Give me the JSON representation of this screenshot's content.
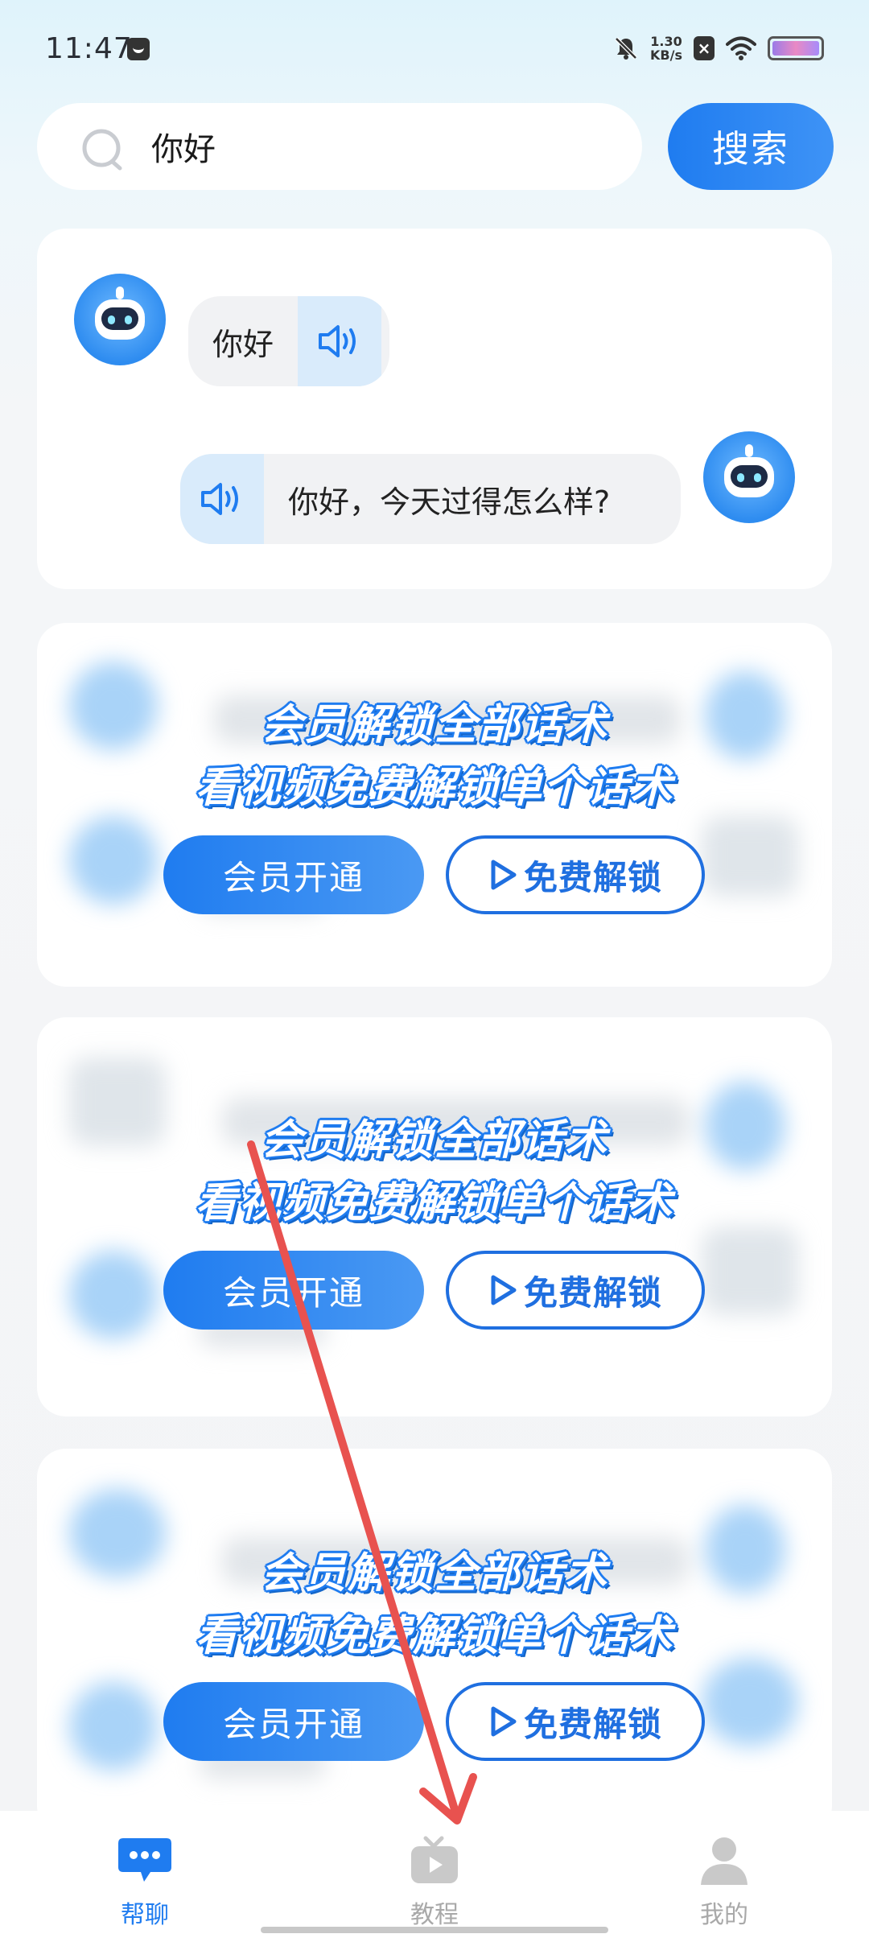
{
  "status_bar": {
    "time": "11:47",
    "speed_value": "1.30",
    "speed_unit": "KB/s"
  },
  "search": {
    "value": "你好",
    "button_label": "搜索"
  },
  "chat": {
    "messages": [
      {
        "from": "bot",
        "text": "你好"
      },
      {
        "from": "user",
        "text": "你好，今天过得怎么样?"
      }
    ]
  },
  "locked_cards": [
    {
      "line1": "会员解锁全部话术",
      "line2": "看视频免费解锁单个话术",
      "member_button": "会员开通",
      "free_button": "免费解锁"
    },
    {
      "line1": "会员解锁全部话术",
      "line2": "看视频免费解锁单个话术",
      "member_button": "会员开通",
      "free_button": "免费解锁"
    },
    {
      "line1": "会员解锁全部话术",
      "line2": "看视频免费解锁单个话术",
      "member_button": "会员开通",
      "free_button": "免费解锁"
    }
  ],
  "bottom_nav": {
    "items": [
      {
        "label": "帮聊",
        "icon": "chat-bubble-icon",
        "active": true
      },
      {
        "label": "教程",
        "icon": "tv-play-icon",
        "active": false
      },
      {
        "label": "我的",
        "icon": "person-icon",
        "active": false
      }
    ]
  },
  "colors": {
    "accent": "#1f7cf0",
    "annotation": "#e8524f"
  }
}
